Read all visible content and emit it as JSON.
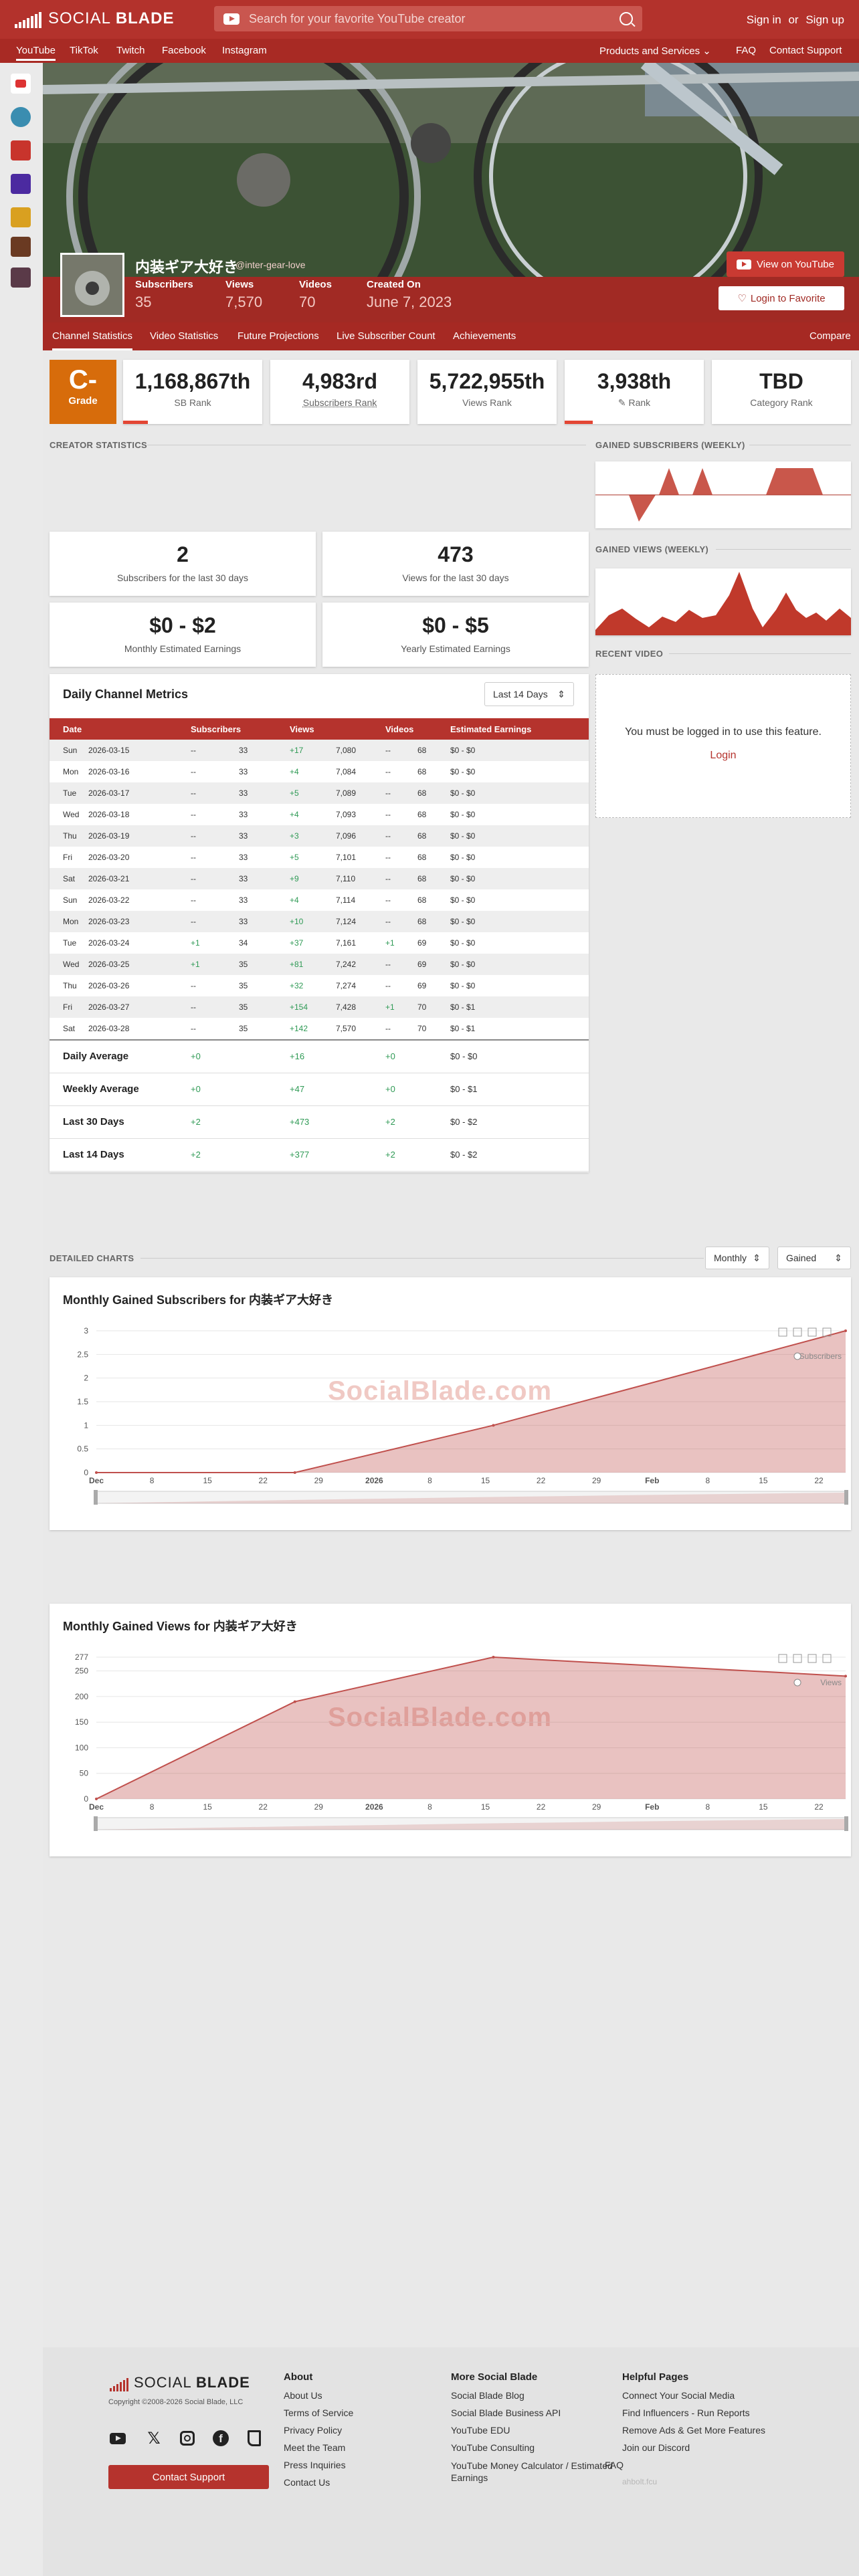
{
  "header": {
    "logo_text_light": "SOCIAL ",
    "logo_text_bold": "BLADE",
    "search_placeholder": "Search for your favorite YouTube creator",
    "sign_in": "Sign in",
    "or": "or",
    "sign_up": "Sign up"
  },
  "nav": {
    "left": [
      "YouTube",
      "TikTok",
      "Twitch",
      "Facebook",
      "Instagram"
    ],
    "products": "Products and Services",
    "faq": "FAQ",
    "contact": "Contact Support"
  },
  "channel": {
    "name": "内装ギア大好き",
    "handle": "@inter-gear-love",
    "stats": [
      {
        "label": "Subscribers",
        "value": "35"
      },
      {
        "label": "Views",
        "value": "7,570"
      },
      {
        "label": "Videos",
        "value": "70"
      },
      {
        "label": "Created On",
        "value": "June 7, 2023"
      }
    ],
    "view_on_youtube": "View on YouTube",
    "login_to_favorite": "Login to Favorite"
  },
  "subnav": {
    "items": [
      "Channel Statistics",
      "Video Statistics",
      "Future Projections",
      "Live Subscriber Count",
      "Achievements"
    ],
    "compare": "Compare"
  },
  "grade": {
    "value": "C-",
    "label": "Grade",
    "color": "#d76c0b"
  },
  "ranks": [
    {
      "value": "1,168,867th",
      "label": "SB Rank",
      "bar": 0.18
    },
    {
      "value": "4,983rd",
      "label": "Subscribers Rank",
      "bar": 0
    },
    {
      "value": "5,722,955th",
      "label": "Views Rank",
      "bar": 0
    },
    {
      "value": "3,938th",
      "label": "Rank",
      "bar": 0.2
    },
    {
      "value": "TBD",
      "label": "Category Rank",
      "bar": 0
    }
  ],
  "sections": {
    "creator_stats": "CREATOR STATISTICS",
    "gained_subs_weekly": "GAINED SUBSCRIBERS (WEEKLY)",
    "gained_views_weekly": "GAINED VIEWS (WEEKLY)",
    "recent_video": "RECENT VIDEO",
    "detailed_charts": "DETAILED CHARTS"
  },
  "summary": [
    {
      "value": "2",
      "label": "Subscribers for the last 30 days"
    },
    {
      "value": "473",
      "label": "Views for the last 30 days"
    },
    {
      "value": "$0 - $2",
      "label": "Monthly Estimated Earnings"
    },
    {
      "value": "$0 - $5",
      "label": "Yearly Estimated Earnings"
    }
  ],
  "recent_video": {
    "message": "You must be logged in to use this feature.",
    "login": "Login"
  },
  "metrics": {
    "title": "Daily Channel Metrics",
    "range": "Last 14 Days",
    "columns": [
      "Date",
      "Subscribers",
      "Views",
      "Videos",
      "Estimated Earnings"
    ],
    "rows": [
      [
        "Sun",
        "2026-03-15",
        "--",
        "33",
        "+17",
        "7,080",
        "--",
        "68",
        "$0 - $0"
      ],
      [
        "Mon",
        "2026-03-16",
        "--",
        "33",
        "+4",
        "7,084",
        "--",
        "68",
        "$0 - $0"
      ],
      [
        "Tue",
        "2026-03-17",
        "--",
        "33",
        "+5",
        "7,089",
        "--",
        "68",
        "$0 - $0"
      ],
      [
        "Wed",
        "2026-03-18",
        "--",
        "33",
        "+4",
        "7,093",
        "--",
        "68",
        "$0 - $0"
      ],
      [
        "Thu",
        "2026-03-19",
        "--",
        "33",
        "+3",
        "7,096",
        "--",
        "68",
        "$0 - $0"
      ],
      [
        "Fri",
        "2026-03-20",
        "--",
        "33",
        "+5",
        "7,101",
        "--",
        "68",
        "$0 - $0"
      ],
      [
        "Sat",
        "2026-03-21",
        "--",
        "33",
        "+9",
        "7,110",
        "--",
        "68",
        "$0 - $0"
      ],
      [
        "Sun",
        "2026-03-22",
        "--",
        "33",
        "+4",
        "7,114",
        "--",
        "68",
        "$0 - $0"
      ],
      [
        "Mon",
        "2026-03-23",
        "--",
        "33",
        "+10",
        "7,124",
        "--",
        "68",
        "$0 - $0"
      ],
      [
        "Tue",
        "2026-03-24",
        "+1",
        "34",
        "+37",
        "7,161",
        "+1",
        "69",
        "$0 - $0"
      ],
      [
        "Wed",
        "2026-03-25",
        "+1",
        "35",
        "+81",
        "7,242",
        "--",
        "69",
        "$0 - $0"
      ],
      [
        "Thu",
        "2026-03-26",
        "--",
        "35",
        "+32",
        "7,274",
        "--",
        "69",
        "$0 - $0"
      ],
      [
        "Fri",
        "2026-03-27",
        "--",
        "35",
        "+154",
        "7,428",
        "+1",
        "70",
        "$0 - $1"
      ],
      [
        "Sat",
        "2026-03-28",
        "--",
        "35",
        "+142",
        "7,570",
        "--",
        "70",
        "$0 - $1"
      ]
    ],
    "averages": [
      {
        "label": "Daily Average",
        "subs": "+0",
        "views": "+16",
        "videos": "+0",
        "earn": "$0 - $0"
      },
      {
        "label": "Weekly Average",
        "subs": "+0",
        "views": "+47",
        "videos": "+0",
        "earn": "$0 - $1"
      },
      {
        "label": "Last 30 Days",
        "subs": "+2",
        "views": "+473",
        "videos": "+2",
        "earn": "$0 - $2"
      },
      {
        "label": "Last 14 Days",
        "subs": "+2",
        "views": "+377",
        "videos": "+2",
        "earn": "$0 - $2"
      }
    ]
  },
  "detailed_controls": {
    "period": "Monthly",
    "mode": "Gained"
  },
  "watermark": "SocialBlade.com",
  "chart_data": [
    {
      "type": "area",
      "title": "Monthly Gained Subscribers for 内装ギア大好き",
      "series": [
        {
          "name": "Subscribers",
          "points": [
            [
              "2025-12-01",
              0
            ],
            [
              "2026-01-01",
              0
            ],
            [
              "2026-02-01",
              1
            ],
            [
              "2026-03-28",
              3
            ]
          ]
        }
      ],
      "yticks": [
        "0",
        "0.5",
        "1",
        "1.5",
        "2",
        "2.5",
        "3"
      ],
      "ylim": [
        0,
        3
      ],
      "xticks": [
        "Dec",
        "8",
        "15",
        "22",
        "29",
        "2026",
        "8",
        "15",
        "22",
        "29",
        "Feb",
        "8",
        "15",
        "22"
      ],
      "color": "#c0504d"
    },
    {
      "type": "area",
      "title": "Monthly Gained Views for 内装ギア大好き",
      "series": [
        {
          "name": "Views",
          "points": [
            [
              "2025-12-01",
              0
            ],
            [
              "2026-01-01",
              190
            ],
            [
              "2026-02-01",
              277
            ],
            [
              "2026-03-28",
              240
            ]
          ]
        }
      ],
      "yticks": [
        "0",
        "50",
        "100",
        "150",
        "200",
        "250",
        "277"
      ],
      "ylim": [
        0,
        277
      ],
      "xticks": [
        "Dec",
        "8",
        "15",
        "22",
        "29",
        "2026",
        "8",
        "15",
        "22",
        "29",
        "Feb",
        "8",
        "15",
        "22"
      ],
      "color": "#c0504d"
    }
  ],
  "footer": {
    "logo_text_light": "SOCIAL ",
    "logo_text_bold": "BLADE",
    "copyright": "Copyright ©2008-2026 Social Blade, LLC",
    "contact_button": "Contact Support",
    "columns": [
      {
        "title": "About",
        "links": [
          "About Us",
          "Terms of Service",
          "Privacy Policy",
          "Meet the Team",
          "Press Inquiries",
          "Contact Us"
        ]
      },
      {
        "title": "More Social Blade",
        "links": [
          "Social Blade Blog",
          "Social Blade Business API",
          "YouTube EDU",
          "YouTube Consulting",
          "YouTube Money Calculator / Estimated Earnings"
        ]
      },
      {
        "title": "Helpful Pages",
        "links": [
          "Connect Your Social Media",
          "Find Influencers - Run Reports",
          "Remove Ads & Get More Features",
          "Join our Discord",
          "FAQ",
          "ahbolt.fcu"
        ]
      }
    ]
  }
}
